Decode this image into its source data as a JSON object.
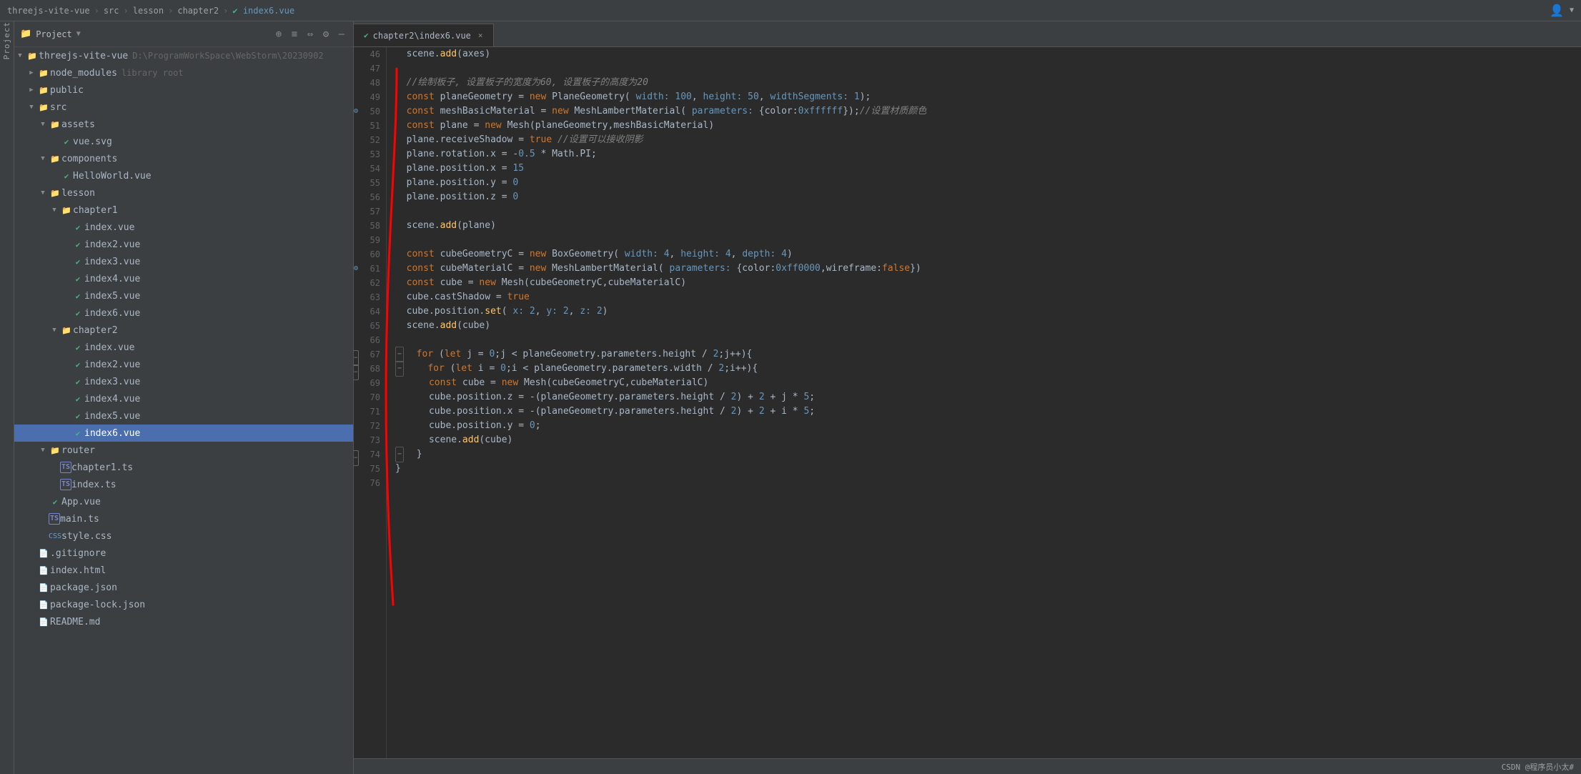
{
  "topbar": {
    "breadcrumbs": [
      "threejs-vite-vue",
      "src",
      "lesson",
      "chapter2",
      "index6.vue"
    ],
    "separators": [
      ">",
      ">",
      ">",
      ">"
    ],
    "user_icon": "👤"
  },
  "sidebar": {
    "title": "Project",
    "caret": "▼",
    "icons": [
      "⊕",
      "≡",
      "⇔",
      "⚙",
      "—"
    ],
    "tree": [
      {
        "id": "threejs-vite-vue",
        "label": "threejs-vite-vue",
        "secondary": "D:\\ProgramWorkSpace\\WebStorm\\20230902",
        "indent": 0,
        "type": "root",
        "expanded": true,
        "icon": "folder"
      },
      {
        "id": "node_modules",
        "label": "node_modules",
        "secondary": "library root",
        "indent": 1,
        "type": "folder",
        "expanded": false,
        "icon": "folder"
      },
      {
        "id": "public",
        "label": "public",
        "indent": 1,
        "type": "folder",
        "expanded": false,
        "icon": "folder"
      },
      {
        "id": "src",
        "label": "src",
        "indent": 1,
        "type": "folder",
        "expanded": true,
        "icon": "folder"
      },
      {
        "id": "assets",
        "label": "assets",
        "indent": 2,
        "type": "folder",
        "expanded": true,
        "icon": "folder"
      },
      {
        "id": "vue-svg",
        "label": "vue.svg",
        "indent": 3,
        "type": "file",
        "icon": "vue"
      },
      {
        "id": "components",
        "label": "components",
        "indent": 2,
        "type": "folder",
        "expanded": true,
        "icon": "folder"
      },
      {
        "id": "HelloWorld",
        "label": "HelloWorld.vue",
        "indent": 3,
        "type": "file",
        "icon": "vue"
      },
      {
        "id": "lesson",
        "label": "lesson",
        "indent": 2,
        "type": "folder",
        "expanded": true,
        "icon": "folder"
      },
      {
        "id": "chapter1",
        "label": "chapter1",
        "indent": 3,
        "type": "folder",
        "expanded": true,
        "icon": "folder"
      },
      {
        "id": "ch1-index1",
        "label": "index.vue",
        "indent": 4,
        "type": "file",
        "icon": "vue"
      },
      {
        "id": "ch1-index2",
        "label": "index2.vue",
        "indent": 4,
        "type": "file",
        "icon": "vue"
      },
      {
        "id": "ch1-index3",
        "label": "index3.vue",
        "indent": 4,
        "type": "file",
        "icon": "vue"
      },
      {
        "id": "ch1-index4",
        "label": "index4.vue",
        "indent": 4,
        "type": "file",
        "icon": "vue"
      },
      {
        "id": "ch1-index5",
        "label": "index5.vue",
        "indent": 4,
        "type": "file",
        "icon": "vue"
      },
      {
        "id": "ch1-index6",
        "label": "index6.vue",
        "indent": 4,
        "type": "file",
        "icon": "vue"
      },
      {
        "id": "chapter2",
        "label": "chapter2",
        "indent": 3,
        "type": "folder",
        "expanded": true,
        "icon": "folder"
      },
      {
        "id": "ch2-index1",
        "label": "index.vue",
        "indent": 4,
        "type": "file",
        "icon": "vue"
      },
      {
        "id": "ch2-index2",
        "label": "index2.vue",
        "indent": 4,
        "type": "file",
        "icon": "vue"
      },
      {
        "id": "ch2-index3",
        "label": "index3.vue",
        "indent": 4,
        "type": "file",
        "icon": "vue"
      },
      {
        "id": "ch2-index4",
        "label": "index4.vue",
        "indent": 4,
        "type": "file",
        "icon": "vue"
      },
      {
        "id": "ch2-index5",
        "label": "index5.vue",
        "indent": 4,
        "type": "file",
        "icon": "vue"
      },
      {
        "id": "ch2-index6",
        "label": "index6.vue",
        "indent": 4,
        "type": "file",
        "icon": "vue",
        "selected": true
      },
      {
        "id": "router",
        "label": "router",
        "indent": 2,
        "type": "folder",
        "expanded": true,
        "icon": "folder"
      },
      {
        "id": "chapter1-ts",
        "label": "chapter1.ts",
        "indent": 3,
        "type": "file",
        "icon": "ts"
      },
      {
        "id": "index-ts",
        "label": "index.ts",
        "indent": 3,
        "type": "file",
        "icon": "ts"
      },
      {
        "id": "App-vue",
        "label": "App.vue",
        "indent": 2,
        "type": "file",
        "icon": "vue"
      },
      {
        "id": "main-ts",
        "label": "main.ts",
        "indent": 2,
        "type": "file",
        "icon": "ts"
      },
      {
        "id": "style-css",
        "label": "style.css",
        "indent": 2,
        "type": "file",
        "icon": "css"
      },
      {
        "id": "gitignore",
        "label": ".gitignore",
        "indent": 1,
        "type": "file",
        "icon": "misc"
      },
      {
        "id": "index-html",
        "label": "index.html",
        "indent": 1,
        "type": "file",
        "icon": "misc"
      },
      {
        "id": "package-json",
        "label": "package.json",
        "indent": 1,
        "type": "file",
        "icon": "misc"
      },
      {
        "id": "package-lock",
        "label": "package-lock.json",
        "indent": 1,
        "type": "file",
        "icon": "misc"
      },
      {
        "id": "README",
        "label": "README.md",
        "indent": 1,
        "type": "file",
        "icon": "misc"
      }
    ]
  },
  "editor": {
    "tab_label": "chapter2\\index6.vue",
    "tab_close": "×"
  },
  "code_lines": [
    {
      "num": 46,
      "content": "  scene.add(axes)"
    },
    {
      "num": 47,
      "content": ""
    },
    {
      "num": 48,
      "content": "  //绘制板子, 设置板子的宽度为60, 设置板子的高度为20"
    },
    {
      "num": 49,
      "content": "  const planeGeometry = new PlaneGeometry( width: 100, height: 50, widthSegments: 1);"
    },
    {
      "num": 50,
      "content": "  const meshBasicMaterial = new MeshLambertMaterial( parameters: {color:0xffffff});//设置材质颜色"
    },
    {
      "num": 51,
      "content": "  const plane = new Mesh(planeGeometry,meshBasicMaterial)"
    },
    {
      "num": 52,
      "content": "  plane.receiveShadow = true //设置可以接收阴影"
    },
    {
      "num": 53,
      "content": "  plane.rotation.x = -0.5 * Math.PI;"
    },
    {
      "num": 54,
      "content": "  plane.position.x = 15"
    },
    {
      "num": 55,
      "content": "  plane.position.y = 0"
    },
    {
      "num": 56,
      "content": "  plane.position.z = 0"
    },
    {
      "num": 57,
      "content": ""
    },
    {
      "num": 58,
      "content": "  scene.add(plane)"
    },
    {
      "num": 59,
      "content": ""
    },
    {
      "num": 60,
      "content": "  const cubeGeometryC = new BoxGeometry( width: 4, height: 4, depth: 4)"
    },
    {
      "num": 61,
      "content": "  const cubeMaterialC = new MeshLambertMaterial( parameters: {color:0xff0000,wireframe:false})"
    },
    {
      "num": 62,
      "content": "  const cube = new Mesh(cubeGeometryC,cubeMaterialC)"
    },
    {
      "num": 63,
      "content": "  cube.castShadow = true"
    },
    {
      "num": 64,
      "content": "  cube.position.set( x: 2, y: 2, z: 2)"
    },
    {
      "num": 65,
      "content": "  scene.add(cube)"
    },
    {
      "num": 66,
      "content": ""
    },
    {
      "num": 67,
      "content": "  for (let j = 0;j < planeGeometry.parameters.height / 2;j++){"
    },
    {
      "num": 68,
      "content": "    for (let i = 0;i < planeGeometry.parameters.width / 2;i++){"
    },
    {
      "num": 69,
      "content": "      const cube = new Mesh(cubeGeometryC,cubeMaterialC)"
    },
    {
      "num": 70,
      "content": "      cube.position.z = -(planeGeometry.parameters.height / 2) + 2 + j * 5;"
    },
    {
      "num": 71,
      "content": "      cube.position.x = -(planeGeometry.parameters.height / 2) + 2 + i * 5;"
    },
    {
      "num": 72,
      "content": "      cube.position.y = 0;"
    },
    {
      "num": 73,
      "content": "      scene.add(cube)"
    },
    {
      "num": 74,
      "content": "  }"
    },
    {
      "num": 75,
      "content": "}"
    },
    {
      "num": 76,
      "content": ""
    }
  ],
  "status_bar": {
    "right_text": "CSDN @程序员小太#"
  }
}
